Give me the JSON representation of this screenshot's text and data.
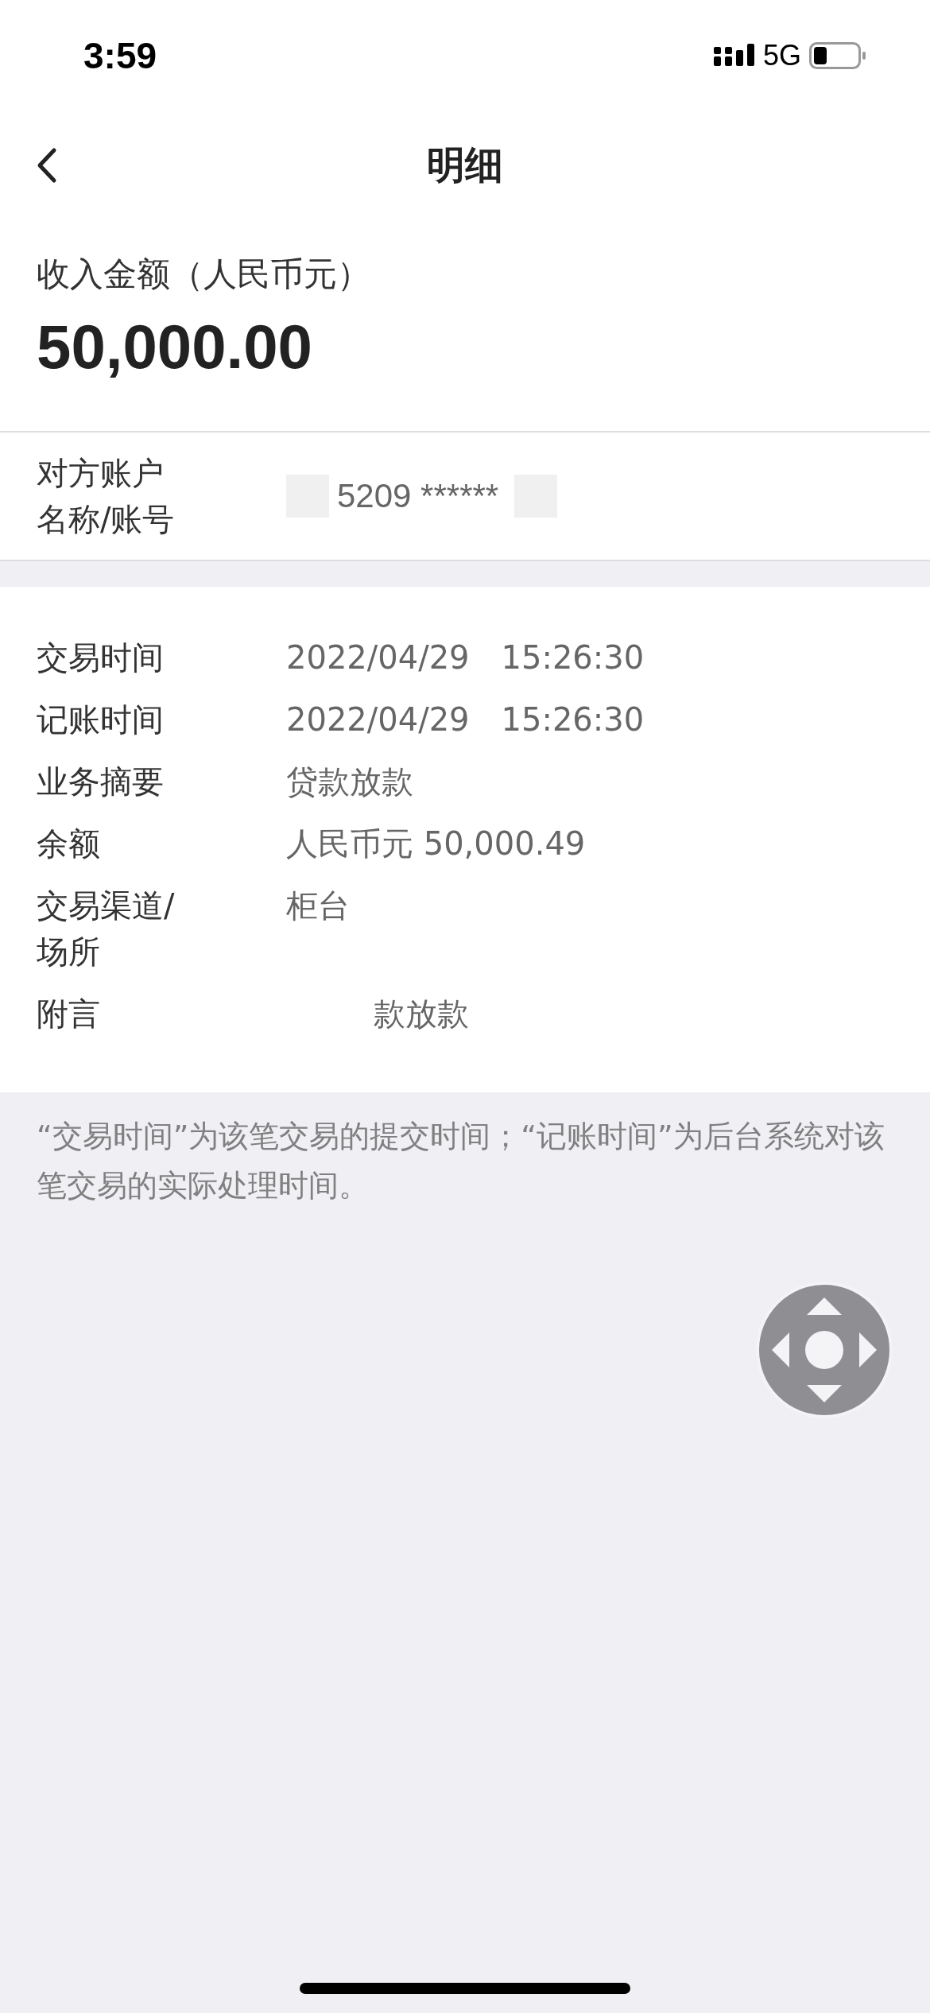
{
  "status_bar": {
    "time": "3:59",
    "network": "5G"
  },
  "nav": {
    "title": "明细"
  },
  "amount": {
    "label": "收入金额（人民币元）",
    "value": "50,000.00"
  },
  "counterparty": {
    "label_lines": [
      "对方账户",
      "名称/账号"
    ],
    "value": "5209 ******"
  },
  "details": [
    {
      "label_lines": [
        "交易时间"
      ],
      "value": "2022/04/29　15:26:30",
      "offset": false
    },
    {
      "label_lines": [
        "记账时间"
      ],
      "value": "2022/04/29　15:26:30",
      "offset": false
    },
    {
      "label_lines": [
        "业务摘要"
      ],
      "value": "贷款放款",
      "offset": false
    },
    {
      "label_lines": [
        "余额"
      ],
      "value": "人民币元 50,000.49",
      "offset": false
    },
    {
      "label_lines": [
        "交易渠道/",
        "场所"
      ],
      "value": "柜台",
      "offset": false
    },
    {
      "label_lines": [
        "附言"
      ],
      "value": "款放款",
      "offset": true
    }
  ],
  "note": "“交易时间”为该笔交易的提交时间；“记账时间”为后台系统对该笔交易的实际处理时间。"
}
